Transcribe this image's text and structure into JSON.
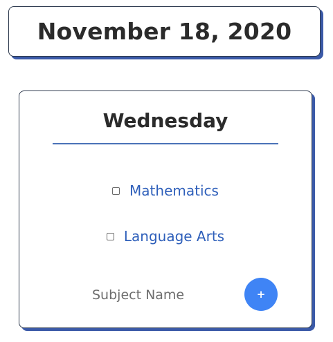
{
  "date": {
    "title": "November 18, 2020"
  },
  "day": {
    "name": "Wednesday",
    "subjects": [
      {
        "label": "Mathematics",
        "checked": false
      },
      {
        "label": "Language Arts",
        "checked": false
      }
    ],
    "new_subject": {
      "placeholder": "Subject Name",
      "value": ""
    },
    "add_button_label": "+"
  },
  "colors": {
    "text_dark": "#2b2b2b",
    "accent_blue": "#3f84f5",
    "link_blue": "#2e5fba",
    "shadow_blue": "#3b5aa8",
    "underline_blue": "#4a72b8"
  },
  "icons": {
    "add": "plus-icon"
  }
}
